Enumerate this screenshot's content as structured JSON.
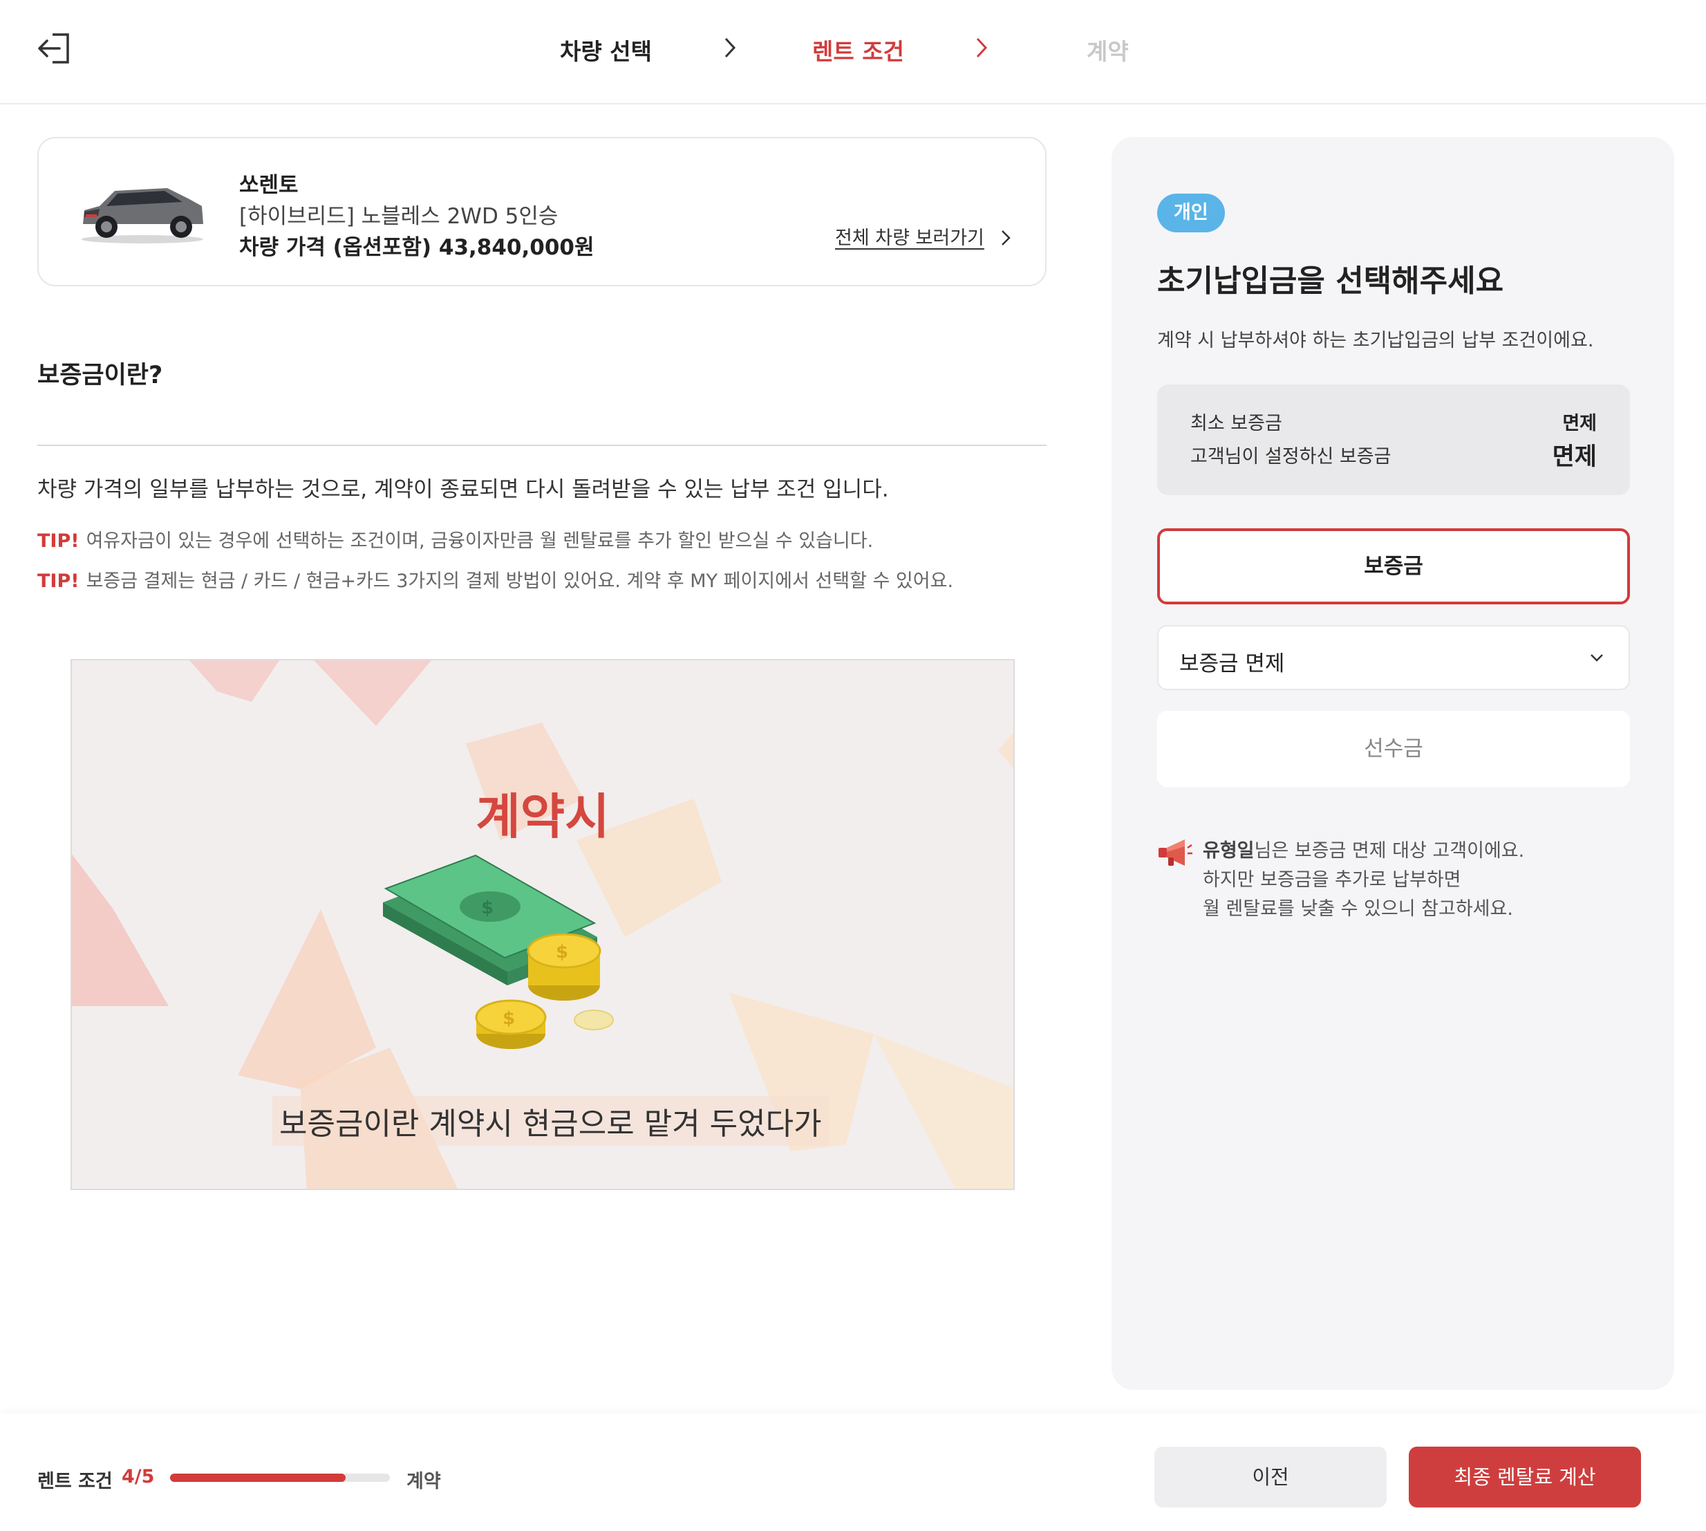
{
  "header": {
    "steps": [
      {
        "label": "차량 선택",
        "state": "done"
      },
      {
        "label": "렌트 조건",
        "state": "active"
      },
      {
        "label": "계약",
        "state": "upcoming"
      }
    ]
  },
  "car": {
    "name": "쏘렌토",
    "trim": "[하이브리드] 노블레스 2WD 5인승",
    "price": "차량 가격 (옵션포함) 43,840,000원",
    "view_all_link": "전체 차량 보러가기"
  },
  "info": {
    "title": "보증금이란?",
    "description": "차량 가격의 일부를 납부하는 것으로, 계약이 종료되면 다시 돌려받을 수 있는 납부 조건 입니다.",
    "tips": [
      {
        "label": "TIP!",
        "text": "여유자금이 있는 경우에 선택하는 조건이며, 금융이자만큼 월 렌탈료를 추가 할인 받으실 수 있습니다."
      },
      {
        "label": "TIP!",
        "text": "보증금 결제는 현금 / 카드 / 현금+카드 3가지의 결제 방법이 있어요. 계약 후 MY 페이지에서 선택할 수 있어요."
      }
    ],
    "video": {
      "title": "계약시",
      "caption": "보증금이란 계약시 현금으로 맡겨 두었다가"
    }
  },
  "panel": {
    "badge": "개인",
    "title": "초기납입금을 선택해주세요",
    "subtitle": "계약 시 납부하셔야 하는 초기납입금의 납부 조건이에요.",
    "min_deposit_label": "최소 보증금",
    "min_deposit_value": "면제",
    "user_deposit_label": "고객님이 설정하신 보증금",
    "user_deposit_value": "면제",
    "options": {
      "deposit": "보증금",
      "deposit_select": "보증금 면제",
      "advance": "선수금"
    },
    "notice": {
      "name": "유형일",
      "line1_rest": "님은 보증금 면제 대상 고객이에요.",
      "line2": "하지만 보증금을 추가로 납부하면",
      "line3": "월 렌탈료를 낮출 수 있으니 참고하세요."
    }
  },
  "footer": {
    "progress_label": "렌트 조건",
    "progress_count": "4/5",
    "progress_fraction": 0.8,
    "next_label": "계약",
    "prev_button": "이전",
    "calc_button": "최종 렌탈료 계산"
  },
  "colors": {
    "accent": "#d23b3b",
    "badge": "#5ab4e8",
    "panel_bg": "#f5f5f7"
  }
}
